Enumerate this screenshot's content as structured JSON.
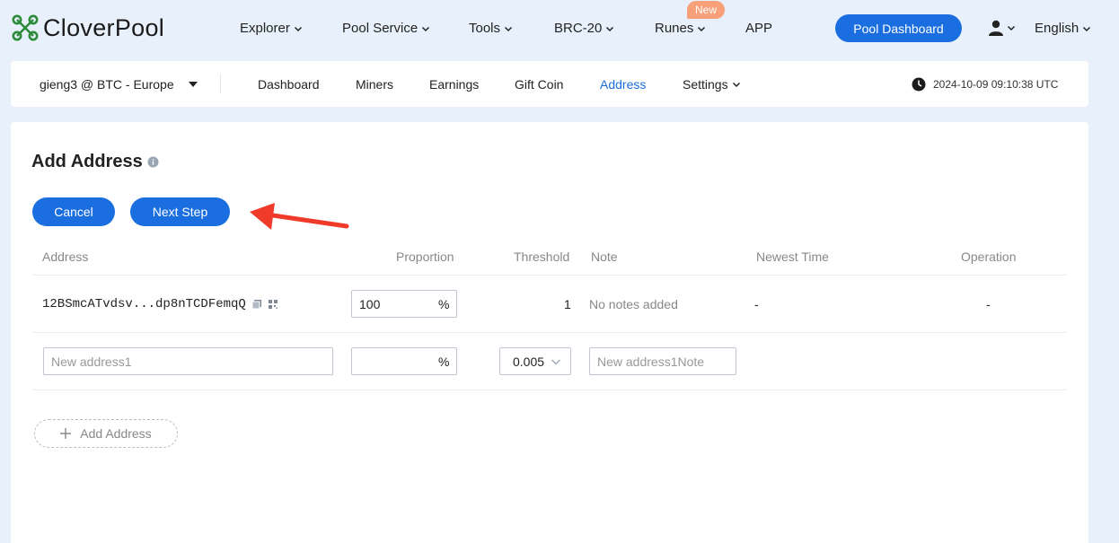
{
  "brand": {
    "name": "CloverPool"
  },
  "nav": {
    "explorer": "Explorer",
    "pool_service": "Pool Service",
    "tools": "Tools",
    "brc20": "BRC-20",
    "runes": "Runes",
    "new_badge": "New",
    "app": "APP",
    "pool_dashboard": "Pool Dashboard",
    "language": "English"
  },
  "subnav": {
    "account": "gieng3 @ BTC - Europe",
    "items": [
      "Dashboard",
      "Miners",
      "Earnings",
      "Gift Coin",
      "Address",
      "Settings"
    ],
    "active": "Address",
    "timestamp": "2024-10-09 09:10:38 UTC"
  },
  "page": {
    "title": "Add Address",
    "cancel": "Cancel",
    "next_step": "Next Step",
    "add_address": "Add Address"
  },
  "table": {
    "headers": [
      "Address",
      "Proportion",
      "Threshold",
      "Note",
      "Newest Time",
      "Operation"
    ],
    "rows": [
      {
        "address": "12BSmcATvdsv...dp8nTCDFemqQ",
        "proportion": "100",
        "threshold": "1",
        "note": "No notes added",
        "newest_time": "-",
        "operation": "-"
      }
    ],
    "new_row": {
      "address_placeholder": "New address1",
      "proportion_value": "",
      "threshold": "0.005",
      "note_placeholder": "New address1Note"
    },
    "percent_sign": "%"
  },
  "colors": {
    "accent": "#1b6ee0",
    "badge": "#f8a07a",
    "arrow": "#f03a2a",
    "logo": "#2e8b3a"
  }
}
